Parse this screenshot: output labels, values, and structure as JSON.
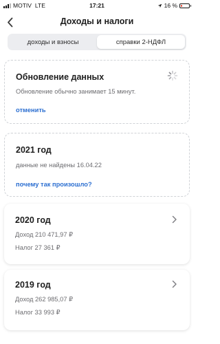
{
  "status_bar": {
    "carrier": "MOTIV",
    "network": "LTE",
    "time": "17:21",
    "battery_text": "16 %",
    "battery_level": 0.16,
    "battery_color": "#e0402f"
  },
  "header": {
    "title": "Доходы и налоги"
  },
  "tabs": [
    {
      "label": "доходы и взносы",
      "active": false
    },
    {
      "label": "справки 2-НДФЛ",
      "active": true
    }
  ],
  "update_card": {
    "title": "Обновление данных",
    "text": "Обновление обычно занимает 15 минут.",
    "action": "отменить"
  },
  "year_2021": {
    "title": "2021 год",
    "text": "данные не найдены 16.04.22",
    "link": "почему так произошло?"
  },
  "year_2020": {
    "title": "2020 год",
    "income": "Доход 210 471,97 ₽",
    "tax": "Налог 27 361 ₽"
  },
  "year_2019": {
    "title": "2019 год",
    "income": "Доход 262 985,07 ₽",
    "tax": "Налог 33 993 ₽"
  },
  "colors": {
    "accent": "#2c6fd1",
    "text_secondary": "#6c6c70"
  }
}
